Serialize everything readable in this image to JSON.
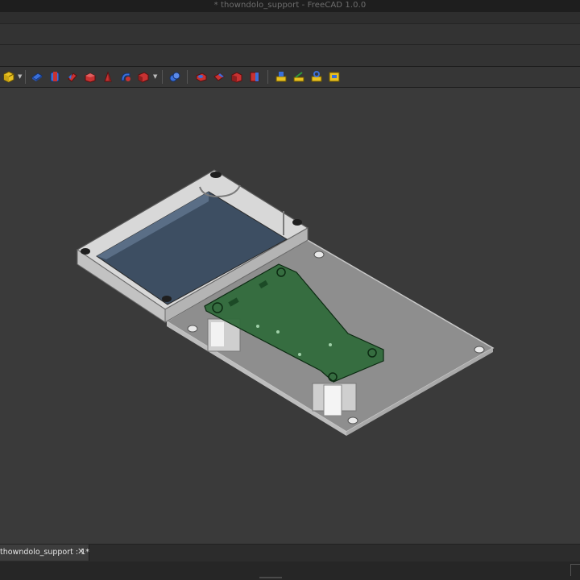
{
  "window": {
    "title": "* thowndolo_support - FreeCAD 1.0.0"
  },
  "toolbar": {
    "buttons": [
      {
        "name": "part-box-icon",
        "color": "#e8c020"
      },
      {
        "name": "part-extrude-icon",
        "color": "#3a6fd8"
      },
      {
        "name": "part-revolve-icon",
        "color": "#3a6fd8"
      },
      {
        "name": "part-mirror-icon",
        "color": "#c83232"
      },
      {
        "name": "part-fillet-icon",
        "color": "#c83232"
      },
      {
        "name": "part-chamfer-icon",
        "color": "#c83232"
      },
      {
        "name": "part-loft-icon",
        "color": "#c83232"
      },
      {
        "name": "part-sweep-icon",
        "color": "#c83232"
      },
      {
        "name": "part-compound-icon",
        "color": "#3a6fd8"
      },
      {
        "name": "part-boolean-icon",
        "color": "#c83232"
      },
      {
        "name": "part-cut-icon",
        "color": "#c83232"
      },
      {
        "name": "part-fuse-icon",
        "color": "#c83232"
      },
      {
        "name": "part-common-icon",
        "color": "#c83232"
      },
      {
        "name": "measure-linear-icon",
        "color": "#e8c020"
      },
      {
        "name": "measure-angular-icon",
        "color": "#e8c020"
      },
      {
        "name": "measure-refresh-icon",
        "color": "#e8c020"
      },
      {
        "name": "measure-toggle-icon",
        "color": "#e8c020"
      }
    ]
  },
  "document_tabs": [
    {
      "label": "thowndolo_support : 1*",
      "close": "✕"
    }
  ],
  "viewport": {
    "background": "#3a3a3a",
    "model_colors": {
      "plate": "#8f8f8f",
      "frame": "#d6d6d6",
      "screen": "#3d4e62",
      "pcb": "#2f6a3a"
    }
  }
}
